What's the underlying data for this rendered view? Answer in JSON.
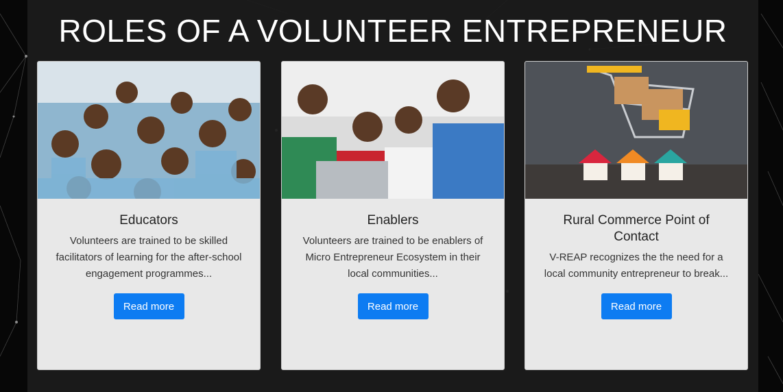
{
  "section": {
    "title": "ROLES OF A VOLUNTEER ENTREPRENEUR"
  },
  "cards": [
    {
      "image_name": "students-group-photo",
      "title": "Educators",
      "text": "Volunteers are trained to be skilled facilitators of learning for the after-school engagement programmes...",
      "button_label": "Read more"
    },
    {
      "image_name": "young-adults-laptop-photo",
      "title": "Enablers",
      "text": "Volunteers are trained to be enablers of Micro Entrepreneur Ecosystem in their local communities...",
      "button_label": "Read more"
    },
    {
      "image_name": "shopping-cart-houses-photo",
      "title": "Rural Commerce Point of Contact",
      "text": "V-REAP recognizes the the need for a local community entrepreneur to break...",
      "button_label": "Read more"
    }
  ],
  "colors": {
    "background": "#070707",
    "section_background": "#1c1c1c",
    "card_background": "#e8e8e8",
    "button": "#0d7cf2"
  }
}
